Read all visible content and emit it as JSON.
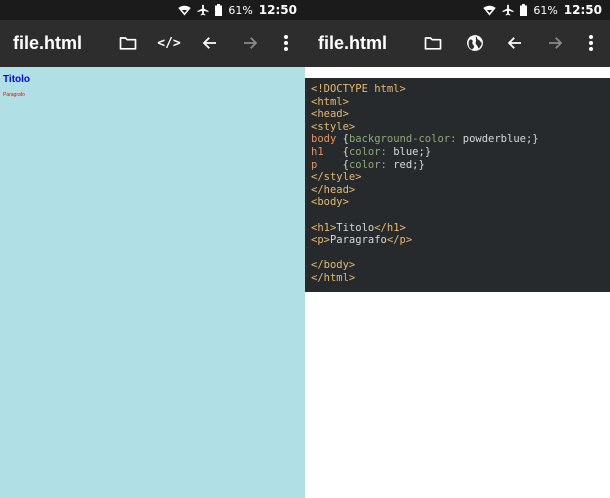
{
  "status": {
    "battery_percent": "61%",
    "time": "12:50"
  },
  "left": {
    "toolbar_title": "file.html",
    "icons": [
      "folder-icon",
      "code-icon",
      "arrow-back-icon",
      "arrow-forward-icon",
      "more-vert-icon"
    ],
    "code_icon_glyph": "</>",
    "preview": {
      "heading": "Titolo",
      "paragraph": "Paragrafo"
    },
    "colors": {
      "background": "#b0dfe5",
      "heading": "#0000ff",
      "paragraph": "#ff0000"
    }
  },
  "right": {
    "toolbar_title": "file.html",
    "icons": [
      "folder-icon",
      "globe-icon",
      "arrow-back-icon",
      "arrow-forward-icon",
      "more-vert-icon"
    ],
    "code": {
      "l1": "<!DOCTYPE html>",
      "l2": "<html>",
      "l3": "<head>",
      "l4": "<style>",
      "l5_sel": "body",
      "l5_open": " {",
      "l5_prop": "background-color:",
      "l5_val": " powderblue;",
      "l5_close": "}",
      "l6_sel": "h1",
      "l6_open": "   {",
      "l6_prop": "color:",
      "l6_val": " blue;",
      "l6_close": "}",
      "l7_sel": "p",
      "l7_open": "    {",
      "l7_prop": "color:",
      "l7_val": " red;",
      "l7_close": "}",
      "l8": "</style>",
      "l9": "</head>",
      "l10": "<body>",
      "l12_open": "<h1>",
      "l12_text": "Titolo",
      "l12_close": "</h1>",
      "l13_open": "<p>",
      "l13_text": "Paragrafo",
      "l13_close": "</p>",
      "l15": "</body>",
      "l16": "</html>"
    }
  }
}
